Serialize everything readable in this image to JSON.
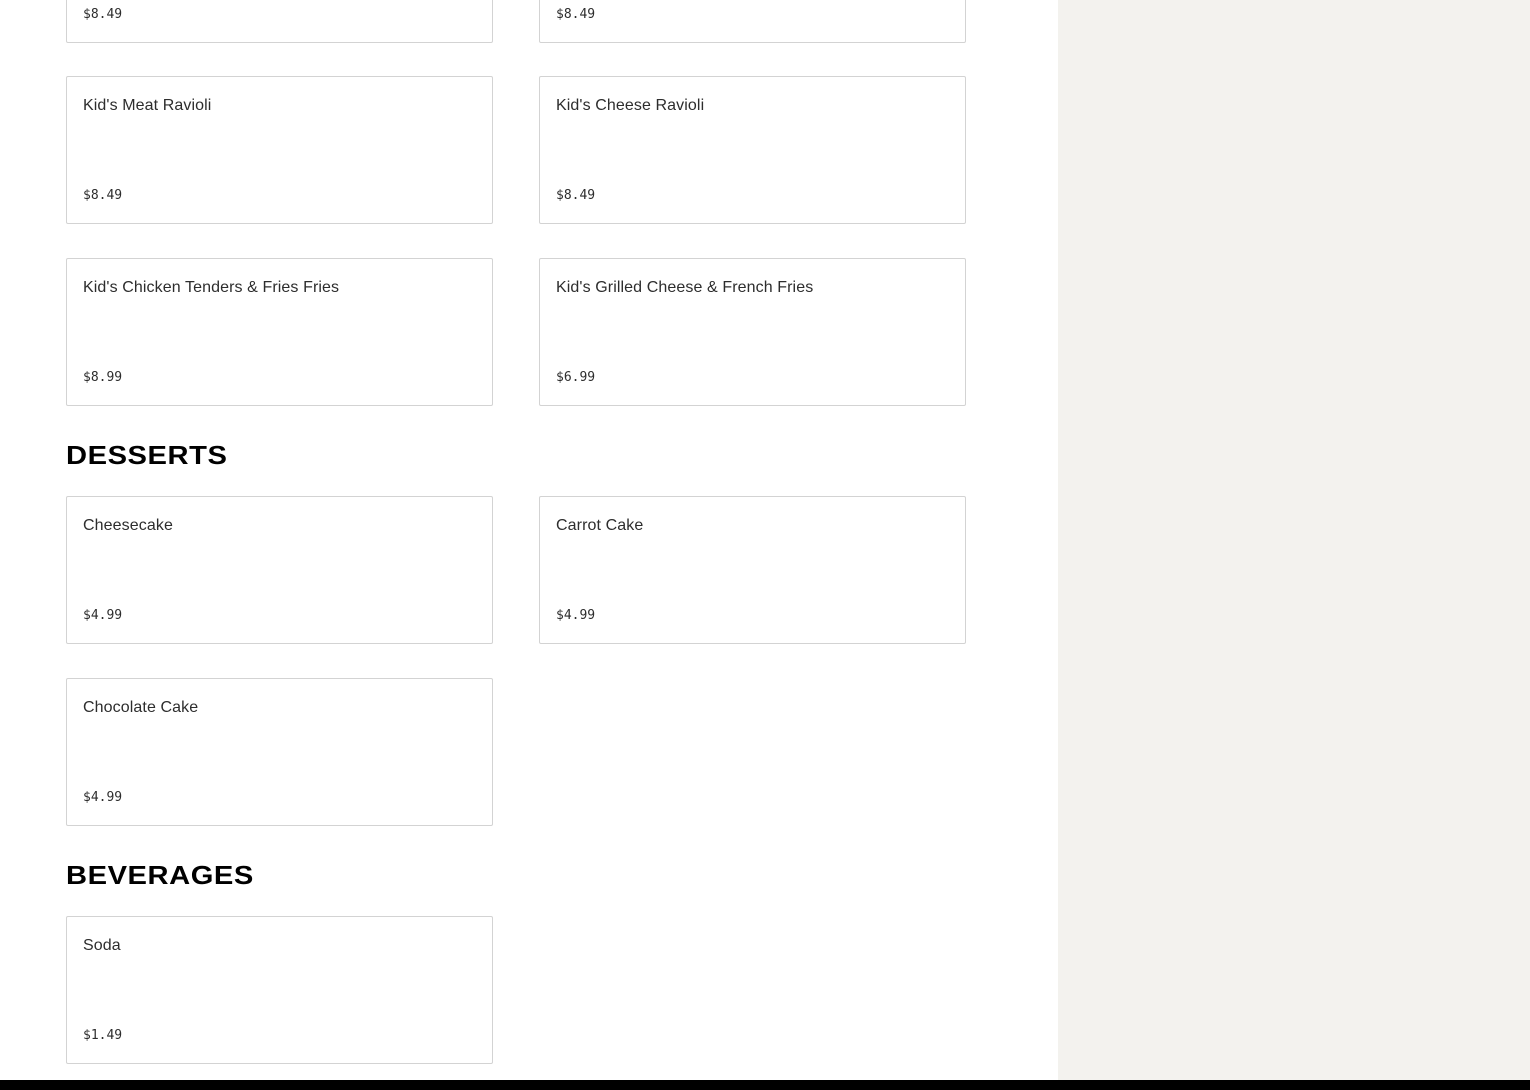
{
  "top_partial_row": [
    {
      "price": "$8.49"
    },
    {
      "price": "$8.49"
    }
  ],
  "kids_items": [
    {
      "name": "Kid's Meat Ravioli",
      "price": "$8.49"
    },
    {
      "name": "Kid's Cheese Ravioli",
      "price": "$8.49"
    },
    {
      "name": "Kid's Chicken Tenders & Fries Fries",
      "price": "$8.99"
    },
    {
      "name": "Kid's Grilled Cheese & French Fries",
      "price": "$6.99"
    }
  ],
  "desserts": {
    "title": "DESSERTS",
    "items": [
      {
        "name": "Cheesecake",
        "price": "$4.99"
      },
      {
        "name": "Carrot Cake",
        "price": "$4.99"
      },
      {
        "name": "Chocolate Cake",
        "price": "$4.99"
      }
    ]
  },
  "beverages": {
    "title": "BEVERAGES",
    "items": [
      {
        "name": "Soda",
        "price": "$1.49"
      }
    ]
  },
  "colors": {
    "side_panel_bg": "#f3f2ee",
    "card_border": "#d3d3d3",
    "footer_bar": "#000000"
  }
}
